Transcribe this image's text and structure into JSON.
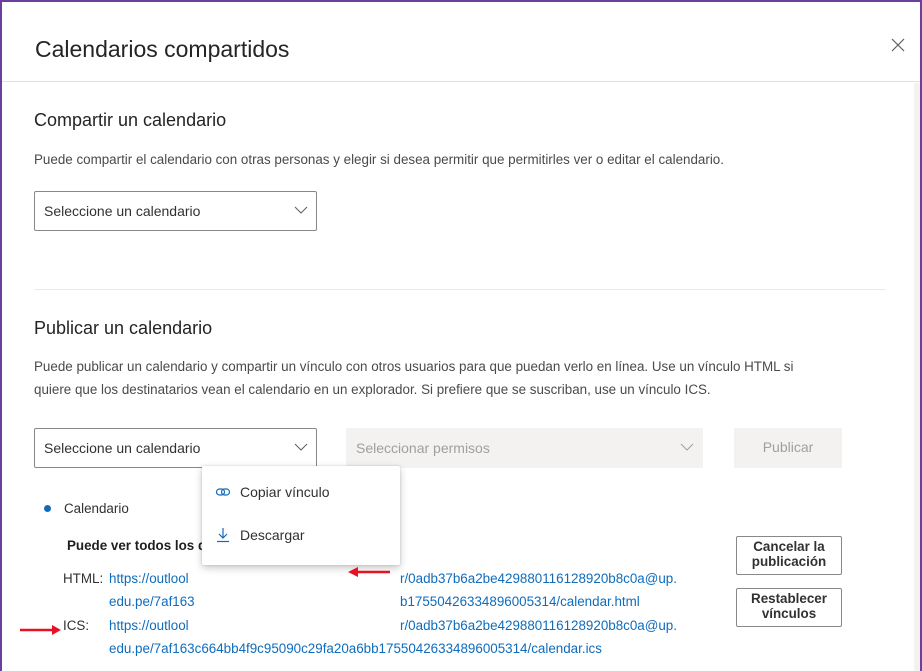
{
  "dialog": {
    "title": "Calendarios compartidos",
    "close_icon": "close-icon"
  },
  "share": {
    "heading": "Compartir un calendario",
    "description": "Puede compartir el calendario con otras personas y elegir si desea permitir que permitirles ver o editar el calendario.",
    "calendar_select": "Seleccione un calendario"
  },
  "publish": {
    "heading": "Publicar un calendario",
    "description_line1": "Puede publicar un calendario y compartir un vínculo con otros usuarios para que puedan verlo en línea. Use un vínculo HTML si",
    "description_line2": "quiere que los destinatarios vean el calendario en un explorador. Si prefiere que se suscriban, use un vínculo ICS.",
    "calendar_select": "Seleccione un calendario",
    "permissions_select": "Seleccionar permisos",
    "publish_button": "Publicar"
  },
  "published": {
    "calendar_name": "Calendario",
    "permission_text": "Puede ver todos los detalles",
    "html_label": "HTML:",
    "html_link_line1_a": "https://outlool",
    "html_link_line1_b": "r/0adb37b6a2be429880116128920b8c0a@up.",
    "html_link_line2_a": "edu.pe/7af163",
    "html_link_line2_b": "b17550426334896005314/calendar.html",
    "ics_label": "ICS:",
    "ics_link_line1_a": "https://outlool",
    "ics_link_line1_b": "r/0adb37b6a2be429880116128920b8c0a@up.",
    "ics_link_line2": "edu.pe/7af163c664bb4f9c95090c29fa20a6bb17550426334896005314/calendar.ics",
    "cancel_button_line1": "Cancelar la",
    "cancel_button_line2": "publicación",
    "reset_button_line1": "Restablecer",
    "reset_button_line2": "vínculos"
  },
  "context_menu": {
    "copy_link": "Copiar vínculo",
    "download": "Descargar"
  },
  "colors": {
    "accent": "#0f6cbd",
    "annotation_arrow": "#e81123"
  }
}
